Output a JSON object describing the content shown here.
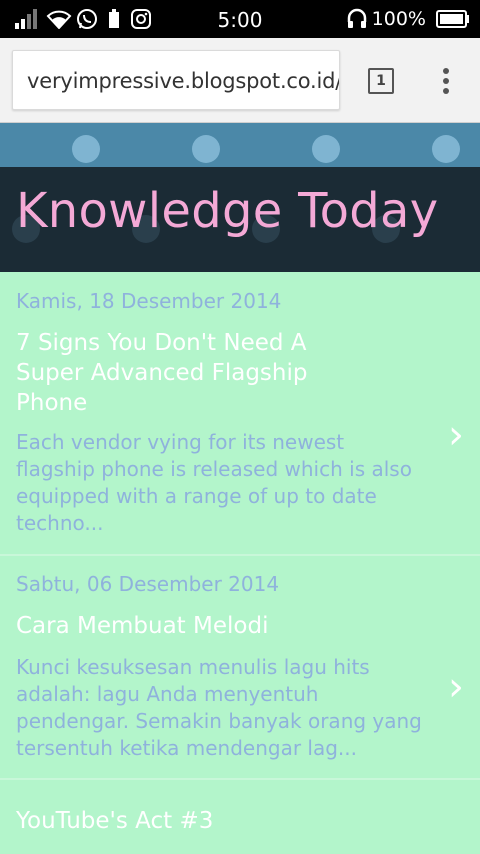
{
  "status_bar": {
    "time": "5:00",
    "battery_percent": "100%"
  },
  "browser": {
    "url": "veryimpressive.blogspot.co.id/",
    "tab_count": "1"
  },
  "blog": {
    "title": "Knowledge Today"
  },
  "posts": [
    {
      "date": "Kamis, 18 Desember 2014",
      "title": "7 Signs You Don't Need A Super Advanced Flagship Phone",
      "snippet": "Each vendor   vying for   its newest flagship   phone is   released   which is also   equipped with  a range of   up to date techno..."
    },
    {
      "date": "Sabtu, 06 Desember 2014",
      "title": "Cara Membuat Melodi",
      "snippet": "Kunci kesuksesan menulis lagu hits adalah:  lagu Anda menyentuh pendengar. Semakin banyak orang yang tersentuh ketika mendengar lag..."
    },
    {
      "title": "YouTube's Act #3"
    }
  ],
  "icons": {
    "chevron": "›"
  }
}
